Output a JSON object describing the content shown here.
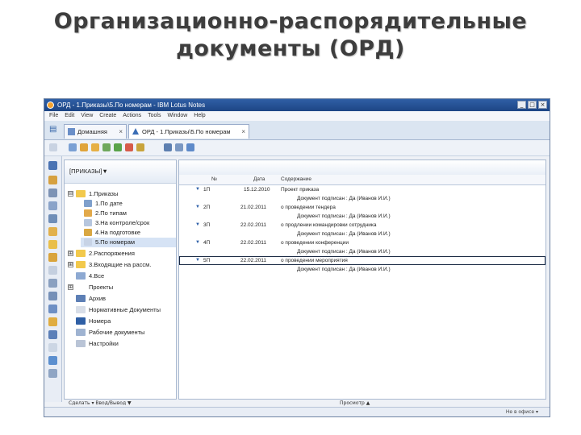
{
  "slide": {
    "title_line1": "Организационно-распорядительные",
    "title_line2": "документы (ОРД)"
  },
  "window": {
    "title": "ОРД - 1.Приказы\\5.По номерам - IBM Lotus Notes",
    "minimize_glyph": "_",
    "maximize_glyph": "□",
    "close_glyph": "×"
  },
  "menu": [
    "File",
    "Edit",
    "View",
    "Create",
    "Actions",
    "Tools",
    "Window",
    "Help"
  ],
  "tabs": [
    {
      "label": "Домашняя",
      "close": "×"
    },
    {
      "label": "ОРД - 1.Приказы\\5.По номерам",
      "close": "×"
    }
  ],
  "nav": {
    "header_label": "[ПРИКАЗЫ]",
    "header_arrow": "▼",
    "items": [
      {
        "label": "1.Приказы",
        "expander": "⊟"
      },
      {
        "label": "1.По дате"
      },
      {
        "label": "2.По типам"
      },
      {
        "label": "3.На контроле/срок"
      },
      {
        "label": "4.На подготовке"
      },
      {
        "label": "5.По номерам"
      },
      {
        "label": "2.Распоряжения",
        "expander": "⊞"
      },
      {
        "label": "3.Входящие на рассм.",
        "expander": "⊞"
      },
      {
        "label": "4.Все"
      },
      {
        "label": "Проекты",
        "expander": "⊞"
      },
      {
        "label": "Архив"
      },
      {
        "label": "Нормативные Документы"
      },
      {
        "label": "Номера"
      },
      {
        "label": "Рабочие документы"
      },
      {
        "label": "Настройки"
      }
    ],
    "footer": "Сделать ▾ Ввод/Вывод ▼"
  },
  "view": {
    "columns": [
      "№",
      "Дата",
      "Содержание"
    ],
    "rows": [
      {
        "num": "1П",
        "date": "15.12.2010",
        "text": "Проект приказа",
        "arrow": "▼"
      },
      {
        "num": "",
        "date": "",
        "text": "Документ подписан : Да (Иванов И.И.)",
        "arrow": ""
      },
      {
        "num": "2П",
        "date": "21.02.2011",
        "text": "о проведении тендера",
        "arrow": "▼"
      },
      {
        "num": "",
        "date": "",
        "text": "Документ подписан : Да (Иванов И.И.)",
        "arrow": ""
      },
      {
        "num": "3П",
        "date": "22.02.2011",
        "text": "о продлении командировки сотрудника",
        "arrow": "▼"
      },
      {
        "num": "",
        "date": "",
        "text": "Документ подписан : Да (Иванов И.И.)",
        "arrow": ""
      },
      {
        "num": "4П",
        "date": "22.02.2011",
        "text": "о проведении конференции",
        "arrow": "▼"
      },
      {
        "num": "",
        "date": "",
        "text": "Документ подписан : Да (Иванов И.И.)",
        "arrow": ""
      },
      {
        "num": "5П",
        "date": "22.02.2011",
        "text": "о проведении мероприятия",
        "arrow": "▼"
      },
      {
        "num": "",
        "date": "",
        "text": "Документ подписан : Да (Иванов И.И.)",
        "arrow": ""
      }
    ],
    "footer": "Просмотр ▲"
  },
  "status": {
    "right": "Не в офисе ▾"
  },
  "colors": {
    "titlebar": "#2f5fa5",
    "folder": "#f2c94c",
    "accent": "#2d5fa8",
    "selection": "#d6e3f5"
  }
}
